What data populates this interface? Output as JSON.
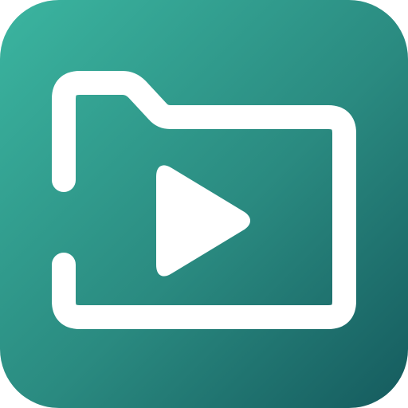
{
  "app_icon": {
    "name": "video-folder-app-icon",
    "colors": {
      "gradient_start": "#3BB5A0",
      "gradient_mid": "#2A8A80",
      "gradient_end": "#155B5E",
      "glyph": "#FFFFFF"
    },
    "icons": {
      "folder": "folder-outline-icon",
      "play": "play-icon"
    }
  }
}
